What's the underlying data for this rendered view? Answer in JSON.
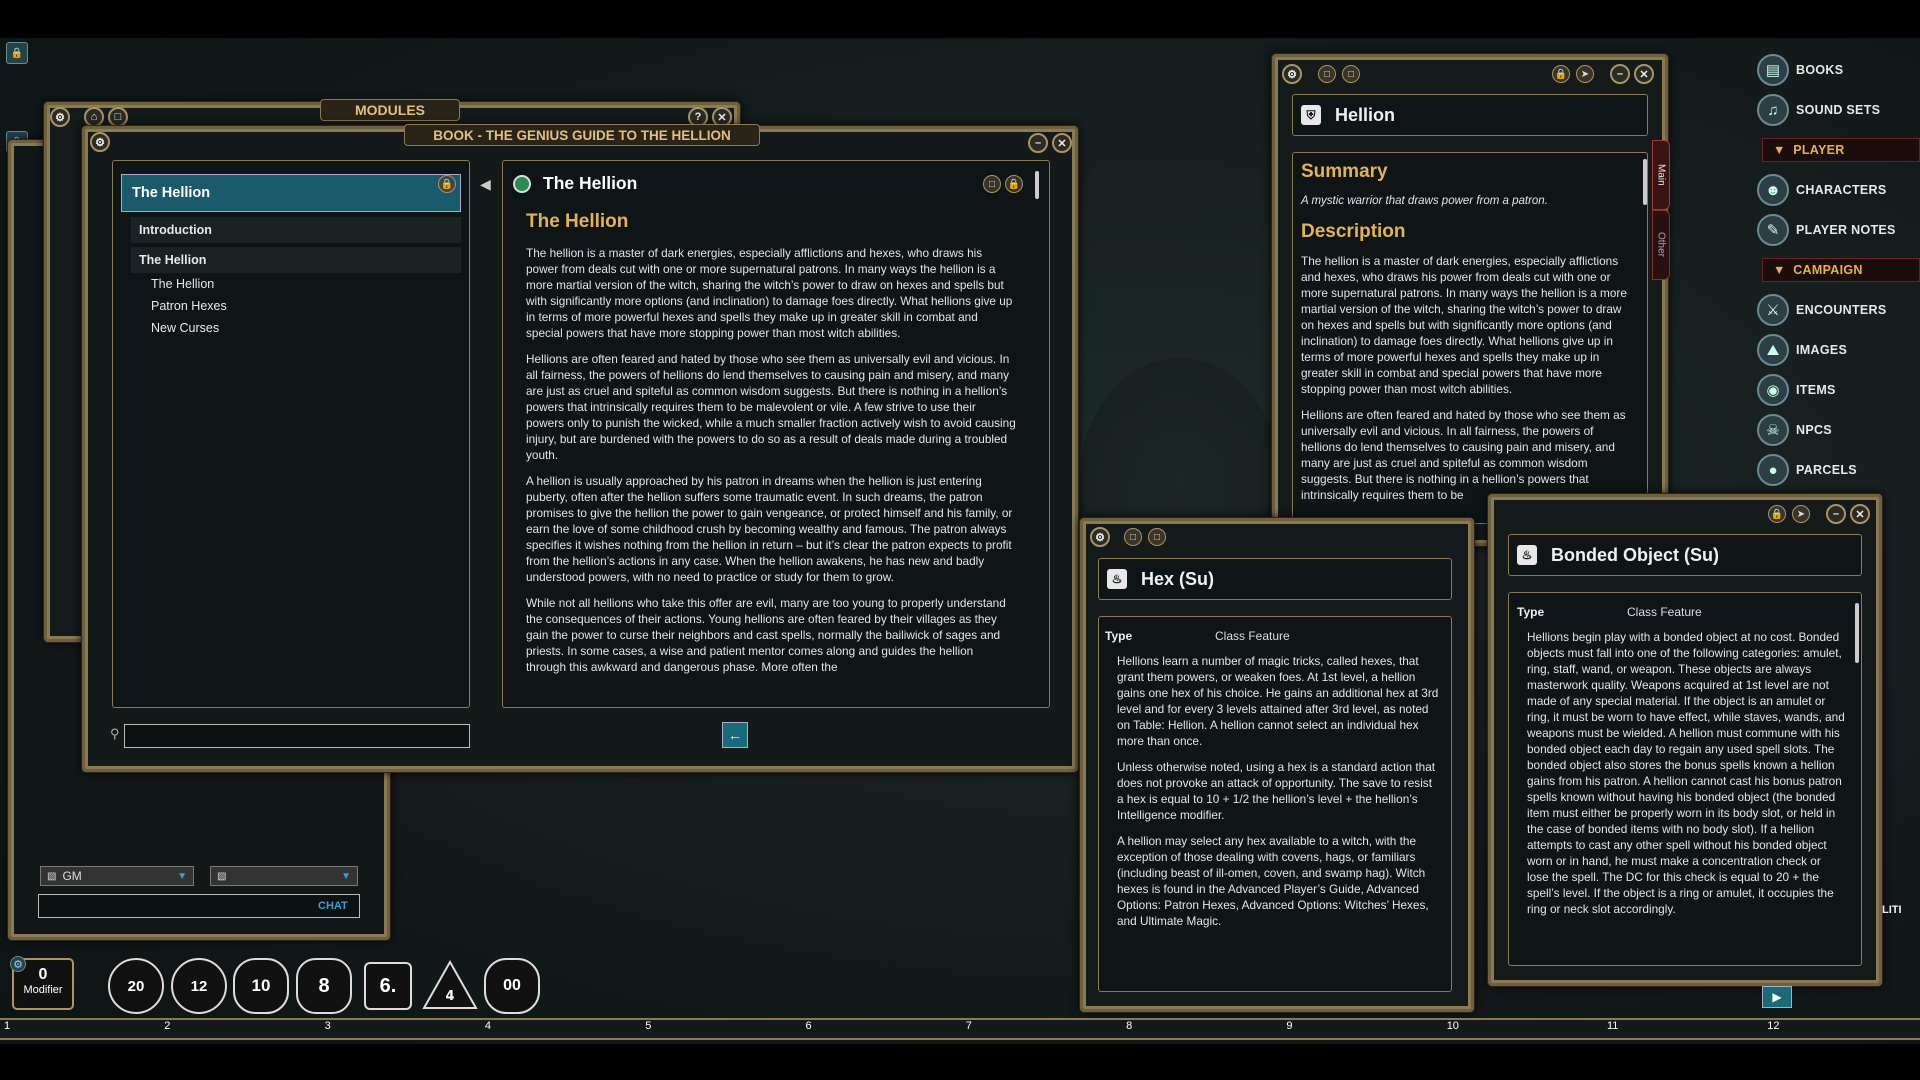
{
  "modules_title": "MODULES",
  "book": {
    "title": "BOOK - THE GENIUS GUIDE TO THE HELLION",
    "toc_header": "The Hellion",
    "toc": [
      "Introduction",
      "The Hellion"
    ],
    "sub_toc": [
      "The Hellion",
      "Patron Hexes",
      "New Curses"
    ],
    "page_title": "The Hellion",
    "heading": "The Hellion",
    "paragraphs": [
      "The hellion is a master of dark energies, especially afflictions and hexes, who draws his power from deals cut with one or more supernatural patrons. In many ways the hellion is a more martial version of the witch, sharing the witch’s power to draw on hexes and spells but with significantly more options (and inclination) to damage foes directly. What hellions give up in terms of more powerful hexes and spells they make up in greater skill in combat and special powers that have more stopping power than most witch abilities.",
      "Hellions are often feared and hated by those who see them as universally evil and vicious. In all fairness, the powers of hellions do lend themselves to causing pain and misery, and many are just as cruel and spiteful as common wisdom suggests. But there is nothing in a hellion’s powers that intrinsically requires them to be malevolent or vile. A few strive to use their powers only to punish the wicked, while a much smaller fraction actively wish to avoid causing injury, but are burdened with the powers to do so as a result of deals made during a troubled youth.",
      "A hellion is usually approached by his patron in dreams when the hellion is just entering puberty, often after the hellion suffers some traumatic event. In such dreams, the patron promises to give the hellion the power to gain vengeance, or protect himself and his family, or earn the love of some childhood crush by becoming wealthy and famous. The patron always specifies it wishes nothing from the hellion in return – but it’s clear the patron expects to profit from the hellion’s actions in any case. When the hellion awakens, he has new and badly understood powers, with no need to practice or study for them to grow.",
      "While not all hellions who take this offer are evil, many are too young to properly understand the consequences of their actions. Young hellions are often feared by their villages as they gain the power to curse their neighbors and cast spells, normally the bailiwick of sages and priests. In some cases, a wise and patient mentor comes along and guides the hellion through this awkward and dangerous phase. More often the"
    ]
  },
  "chat": {
    "identity": "GM",
    "target": "",
    "button": "CHAT"
  },
  "modifier": {
    "value": "0",
    "label": "Modifier"
  },
  "dice": [
    "20",
    "12",
    "10",
    "8",
    "6.",
    "4",
    "00"
  ],
  "hotkeys": [
    "1",
    "2",
    "3",
    "4",
    "5",
    "6",
    "7",
    "8",
    "9",
    "10",
    "11",
    "12"
  ],
  "hellion": {
    "title": "Hellion",
    "summary_h": "Summary",
    "summary": "A mystic warrior that draws power from a patron.",
    "desc_h": "Description",
    "desc": [
      "The hellion is a master of dark energies, especially afflictions and hexes, who draws his power from deals cut with one or more supernatural patrons. In many ways the hellion is a more martial version of the witch, sharing the witch’s power to draw on hexes and spells but with significantly more options (and inclination) to damage foes directly. What hellions give up in terms of more powerful hexes and spells they make up in greater skill in combat and special powers that have more stopping power than most witch abilities.",
      "Hellions are often feared and hated by those who see them as universally evil and vicious. In all fairness, the powers of hellions do lend themselves to causing pain and misery, and many are just as cruel and spiteful as common wisdom suggests. But there is nothing in a hellion’s powers that intrinsically requires them to be"
    ],
    "tab_main": "Main",
    "tab_other": "Other"
  },
  "hex": {
    "title": "Hex (Su)",
    "type_label": "Type",
    "type_value": "Class Feature",
    "paragraphs": [
      "Hellions learn a number of magic tricks, called hexes, that grant them powers, or weaken foes. At 1st level, a hellion gains one hex of his choice. He gains an additional hex at 3rd level and for every 3 levels attained after 3rd level, as noted on Table: Hellion. A hellion cannot select an individual hex more than once.",
      "Unless otherwise noted, using a hex is a standard action that does not provoke an attack of opportunity. The save to resist a hex is equal to 10 + 1/2 the hellion’s level + the hellion’s Intelligence modifier.",
      "A hellion may select any hex available to a witch, with the exception of those dealing with covens, hags, or familiars (including beast of ill-omen, coven, and swamp hag). Witch hexes is found in the Advanced Player’s Guide, Advanced Options: Patron Hexes, Advanced Options: Witches’ Hexes, and Ultimate Magic."
    ]
  },
  "bonded": {
    "title": "Bonded Object (Su)",
    "type_label": "Type",
    "type_value": "Class Feature",
    "text": "Hellions begin play with a bonded object at no cost. Bonded objects must fall into one of the following categories: amulet, ring, staff, wand, or weapon. These objects are always masterwork quality. Weapons acquired at 1st level are not made of any special material. If the object is an amulet or ring, it must be worn to have effect, while staves, wands, and weapons must be wielded. A hellion must commune with his bonded object each day to regain any used spell slots. The bonded object also stores the bonus spells known a hellion gains from his patron. A hellion cannot cast his bonus patron spells known without having his bonded object (the bonded item must either be properly worn in its body slot, or held in the case of bonded items with no body slot). If a hellion attempts to cast any other spell without his bonded object worn or in hand, he must make a concentration check or lose the spell. The DC for this check is equal to 20 + the spell’s level. If the object is a ring or amulet, it occupies the ring or neck slot accordingly."
  },
  "sidebar": {
    "books": "BOOKS",
    "sound_sets": "SOUND SETS",
    "player": "PLAYER",
    "characters": "CHARACTERS",
    "player_notes": "PLAYER NOTES",
    "campaign": "CAMPAIGN",
    "encounters": "ENCOUNTERS",
    "images": "IMAGES",
    "items": "ITEMS",
    "npcs": "NPCS",
    "parcels": "PARCELS",
    "lit": "LITI"
  }
}
